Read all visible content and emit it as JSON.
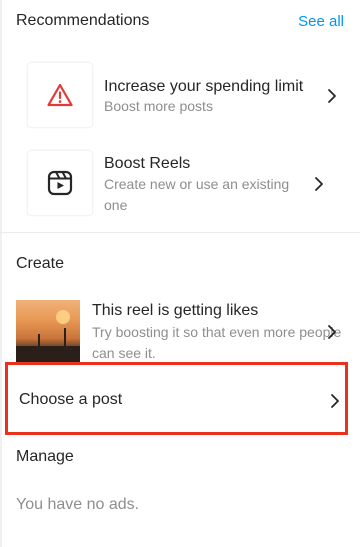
{
  "recommendations": {
    "title": "Recommendations",
    "see_all": "See all",
    "items": [
      {
        "title": "Increase your spending limit",
        "subtitle": "Boost more posts",
        "icon": "warning-triangle-icon"
      },
      {
        "title": "Boost Reels",
        "subtitle": "Create new or use an existing one",
        "icon": "reels-icon"
      }
    ]
  },
  "create": {
    "title": "Create",
    "reel": {
      "title": "This reel is getting likes",
      "subtitle": "Try boosting it so that even more people can see it."
    },
    "choose_post": "Choose a post"
  },
  "manage": {
    "title": "Manage",
    "empty": "You have no ads."
  },
  "colors": {
    "accent": "#0095f6",
    "warning": "#e53935",
    "highlight": "#e8321e"
  }
}
